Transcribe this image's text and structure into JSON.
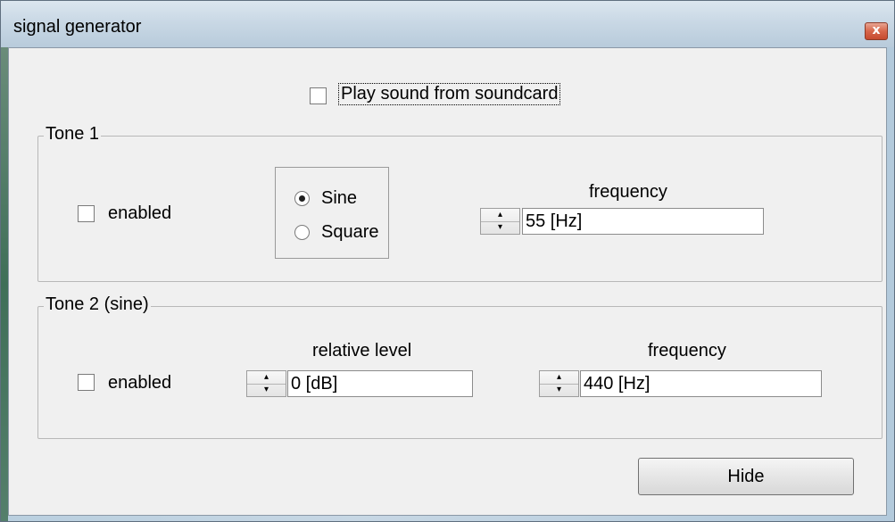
{
  "window": {
    "title": "signal generator",
    "close_glyph": "x"
  },
  "play_sound": {
    "label": "Play sound from soundcard",
    "checked": false
  },
  "tone1": {
    "group_label": "Tone 1",
    "enabled_label": "enabled",
    "enabled": false,
    "waveform": {
      "options": [
        "Sine",
        "Square"
      ],
      "selected": "Sine"
    },
    "frequency_label": "frequency",
    "frequency_value": "55 [Hz]"
  },
  "tone2": {
    "group_label": "Tone 2 (sine)",
    "enabled_label": "enabled",
    "enabled": false,
    "relative_level_label": "relative level",
    "relative_level_value": "0 [dB]",
    "frequency_label": "frequency",
    "frequency_value": "440 [Hz]"
  },
  "hide_button_label": "Hide",
  "icons": {
    "spinner_up": "▴",
    "spinner_down": "▾"
  },
  "colors": {
    "title_bar": "#c9d8e5",
    "client_bg": "#f0f0f0",
    "close_button": "#d7654a"
  }
}
